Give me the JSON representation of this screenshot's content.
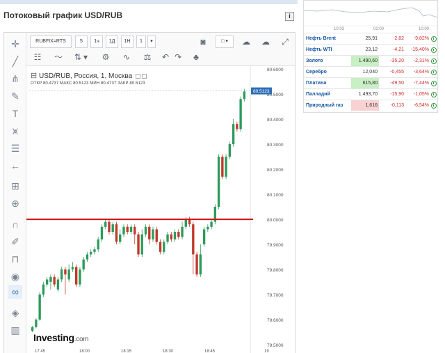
{
  "widget": {
    "title": "Потоковый график USD/RUB",
    "info_icon": "i"
  },
  "toolbar": {
    "symbol": "RUBFIX=RTS",
    "intervals": [
      "5",
      "1ч",
      "1Д",
      "1Н"
    ],
    "interval_value": "1",
    "interval_dropdown_icon": "▾"
  },
  "chart_legend": {
    "collapse_symbol": "⊟",
    "title": "USD/RUB, Россия, 1, Москва",
    "ohlc": "ОТКР 80.4737  МАКС 80.5123  МИН 80.4737  ЗАКР 80.5123"
  },
  "logo": {
    "brand": "Investing",
    "suffix": ".com"
  },
  "chart_data": {
    "type": "candlestick",
    "title": "USD/RUB, Россия, 1, Москва",
    "y_ticks": [
      "80.6000",
      "80.5000",
      "80.4000",
      "80.3000",
      "80.2000",
      "80.1000",
      "80.0000",
      "79.9000",
      "79.8000",
      "79.7000",
      "79.6000",
      "79.5000"
    ],
    "ylim": [
      79.5,
      80.6
    ],
    "current_price_label": "80.5123",
    "current_price": 80.5123,
    "horizontal_line": {
      "value": 80.0,
      "color": "#d11a1a"
    },
    "x_ticks": [
      "17:45",
      "18:00",
      "18:15",
      "18:30",
      "18:45",
      "19"
    ],
    "candles": [
      [
        79.555,
        79.57,
        79.55,
        79.575,
        "up"
      ],
      [
        79.57,
        79.6,
        79.565,
        79.605,
        "up"
      ],
      [
        79.6,
        79.7,
        79.595,
        79.71,
        "up"
      ],
      [
        79.7,
        79.74,
        79.69,
        79.75,
        "up"
      ],
      [
        79.74,
        79.76,
        79.73,
        79.77,
        "up"
      ],
      [
        79.75,
        79.77,
        79.72,
        79.78,
        "up"
      ],
      [
        79.77,
        79.74,
        79.73,
        79.78,
        "down"
      ],
      [
        79.72,
        79.76,
        79.71,
        79.77,
        "up"
      ],
      [
        79.76,
        79.8,
        79.75,
        79.81,
        "up"
      ],
      [
        79.8,
        79.78,
        79.7,
        79.81,
        "down"
      ],
      [
        79.76,
        79.8,
        79.75,
        79.82,
        "up"
      ],
      [
        79.8,
        79.81,
        79.79,
        79.83,
        "up"
      ],
      [
        79.81,
        79.74,
        79.73,
        79.82,
        "down"
      ],
      [
        79.74,
        79.8,
        79.73,
        79.81,
        "up"
      ],
      [
        79.8,
        79.84,
        79.79,
        79.85,
        "up"
      ],
      [
        79.84,
        79.86,
        79.83,
        79.87,
        "up"
      ],
      [
        79.86,
        79.87,
        79.85,
        79.88,
        "up"
      ],
      [
        79.87,
        79.88,
        79.86,
        79.89,
        "up"
      ],
      [
        79.88,
        79.92,
        79.87,
        79.93,
        "up"
      ],
      [
        79.92,
        79.97,
        79.91,
        79.98,
        "up"
      ],
      [
        79.97,
        79.99,
        79.96,
        80.0,
        "up"
      ],
      [
        79.99,
        79.95,
        79.94,
        80.0,
        "down"
      ],
      [
        79.95,
        79.98,
        79.94,
        79.99,
        "up"
      ],
      [
        79.98,
        79.91,
        79.9,
        79.99,
        "down"
      ],
      [
        79.91,
        79.94,
        79.9,
        79.96,
        "up"
      ],
      [
        79.94,
        79.97,
        79.93,
        79.98,
        "up"
      ],
      [
        79.97,
        79.95,
        79.94,
        79.98,
        "down"
      ],
      [
        79.95,
        79.97,
        79.94,
        79.98,
        "up"
      ],
      [
        79.97,
        79.94,
        79.9,
        79.98,
        "down"
      ],
      [
        79.94,
        79.86,
        79.85,
        79.95,
        "down"
      ],
      [
        79.86,
        79.94,
        79.85,
        79.96,
        "up"
      ],
      [
        79.94,
        79.97,
        79.93,
        79.98,
        "up"
      ],
      [
        79.97,
        79.92,
        79.9,
        79.98,
        "down"
      ],
      [
        79.92,
        79.96,
        79.91,
        79.97,
        "up"
      ],
      [
        79.96,
        79.91,
        79.9,
        79.97,
        "down"
      ],
      [
        79.91,
        79.87,
        79.86,
        79.92,
        "down"
      ],
      [
        79.87,
        79.91,
        79.86,
        79.92,
        "up"
      ],
      [
        79.91,
        79.94,
        79.9,
        79.95,
        "up"
      ],
      [
        79.94,
        79.92,
        79.91,
        79.95,
        "down"
      ],
      [
        79.92,
        79.95,
        79.91,
        79.96,
        "up"
      ],
      [
        79.95,
        79.93,
        79.92,
        79.96,
        "down"
      ],
      [
        79.93,
        79.97,
        79.92,
        79.99,
        "up"
      ],
      [
        79.97,
        80.0,
        79.96,
        80.01,
        "up"
      ],
      [
        80.0,
        79.98,
        79.97,
        80.01,
        "down"
      ],
      [
        79.98,
        79.86,
        79.78,
        79.99,
        "down"
      ],
      [
        79.86,
        79.78,
        79.77,
        79.87,
        "down"
      ],
      [
        79.78,
        79.86,
        79.77,
        79.9,
        "up"
      ],
      [
        79.9,
        79.96,
        79.89,
        79.97,
        "up"
      ],
      [
        79.96,
        79.97,
        79.95,
        79.98,
        "up"
      ],
      [
        79.97,
        79.99,
        79.96,
        80.0,
        "up"
      ],
      [
        79.99,
        80.05,
        79.98,
        80.06,
        "up"
      ],
      [
        80.05,
        80.25,
        80.04,
        80.26,
        "up"
      ],
      [
        80.25,
        80.17,
        80.16,
        80.26,
        "down"
      ],
      [
        80.17,
        80.25,
        80.16,
        80.26,
        "up"
      ],
      [
        80.25,
        80.3,
        80.24,
        80.31,
        "up"
      ],
      [
        80.3,
        80.38,
        80.29,
        80.4,
        "up"
      ],
      [
        80.38,
        80.36,
        80.35,
        80.39,
        "down"
      ],
      [
        80.36,
        80.48,
        80.35,
        80.49,
        "up"
      ],
      [
        80.48,
        80.51,
        80.47,
        80.52,
        "up"
      ]
    ]
  },
  "commodities": {
    "mini_chart_times": [
      "10:03",
      "02:00",
      "10:00"
    ],
    "rows": [
      {
        "name": "Нефть Brent",
        "last": "25,91",
        "change": "-2,82",
        "pct": "-9,82%",
        "hl": ""
      },
      {
        "name": "Нефть WTI",
        "last": "23,12",
        "change": "-4,21",
        "pct": "-15,40%",
        "hl": ""
      },
      {
        "name": "Золото",
        "last": "1.490,60",
        "change": "-35,20",
        "pct": "-2,31%",
        "hl": "green"
      },
      {
        "name": "Серебро",
        "last": "12,040",
        "change": "-0,455",
        "pct": "-3,64%",
        "hl": ""
      },
      {
        "name": "Платина",
        "last": "615,80",
        "change": "-49,50",
        "pct": "-7,44%",
        "hl": "green"
      },
      {
        "name": "Палладий",
        "last": "1.493,70",
        "change": "-15,90",
        "pct": "-1,05%",
        "hl": ""
      },
      {
        "name": "Природный газ",
        "last": "1,616",
        "change": "-0,113",
        "pct": "-6,54%",
        "hl": "red"
      }
    ],
    "colors": {
      "negative": "#d12b2b",
      "link": "#1256a0",
      "up_candle": "#2e9a5c",
      "down_candle": "#c0392b"
    }
  }
}
